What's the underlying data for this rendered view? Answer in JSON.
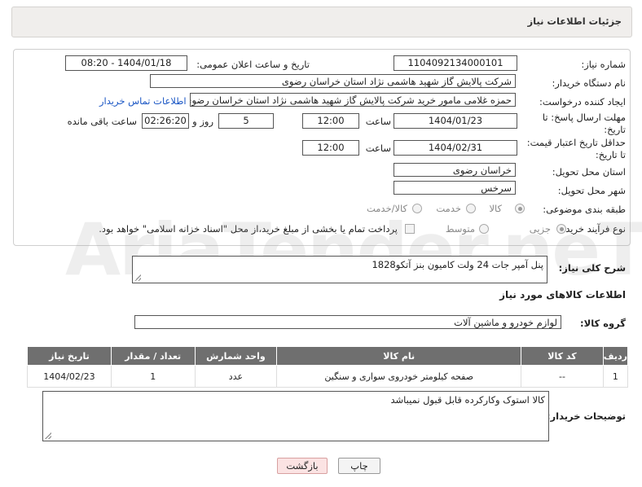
{
  "header": {
    "title": "جزئیات اطلاعات نیاز"
  },
  "form": {
    "need_number_label": "شماره نیاز:",
    "need_number": "1104092134000101",
    "announce_label": "تاریخ و ساعت اعلان عمومی:",
    "announce_value": "1404/01/18 - 08:20",
    "buyer_org_label": "نام دستگاه خریدار:",
    "buyer_org": "شرکت پالایش گاز شهید هاشمی نژاد   استان خراسان رضوی",
    "requester_label": "ایجاد کننده درخواست:",
    "requester": "حمزه غلامی مامور خرید شرکت پالایش گاز شهید هاشمی نژاد   استان خراسان رضوی",
    "contact_link": "اطلاعات تماس خریدار",
    "reply_deadline_label": "مهلت ارسال پاسخ: تا تاریخ:",
    "reply_date": "1404/01/23",
    "time_label": "ساعت",
    "reply_time": "12:00",
    "days": "5",
    "days_label": "روز و",
    "remaining": "02:26:20",
    "remaining_label": "ساعت باقی مانده",
    "price_validity_label": "حداقل تاریخ اعتبار قیمت: تا تاریخ:",
    "price_date": "1404/02/31",
    "price_time": "12:00",
    "province_label": "استان محل تحویل:",
    "province": "خراسان رضوی",
    "city_label": "شهر محل تحویل:",
    "city": "سرخس",
    "category_label": "طبقه بندی موضوعی:",
    "category_options": [
      "کالا",
      "خدمت",
      "کالا/خدمت"
    ],
    "category_selected": "کالا",
    "process_label": "نوع فرآیند خرید :",
    "process_options": [
      "جزیی",
      "متوسط"
    ],
    "payment_note": "پرداخت تمام یا بخشی از مبلغ خرید،از محل \"اسناد خزانه اسلامی\" خواهد بود."
  },
  "description": {
    "label": "شرح کلی نیاز:",
    "value": "پنل آمپر جات 24 ولت کامیون بنز آتکو1828"
  },
  "goods": {
    "section_title": "اطلاعات کالاهای مورد نیاز",
    "group_label": "گروه کالا:",
    "group_value": "لوازم خودرو و ماشین آلات",
    "columns": [
      "ردیف",
      "کد کالا",
      "نام کالا",
      "واحد شمارش",
      "تعداد / مقدار",
      "تاریخ نیاز"
    ],
    "rows": [
      [
        "1",
        "--",
        "صفحه کیلومتر خودروی سواری و سنگین",
        "عدد",
        "1",
        "1404/02/23"
      ]
    ]
  },
  "buyer_notes": {
    "label": "توضیحات خریدار:",
    "value": "کالا استوک وکارکرده قابل قبول نمیباشد"
  },
  "buttons": {
    "print": "چاپ",
    "back": "بازگشت"
  },
  "watermark": "AriaTender.neT"
}
